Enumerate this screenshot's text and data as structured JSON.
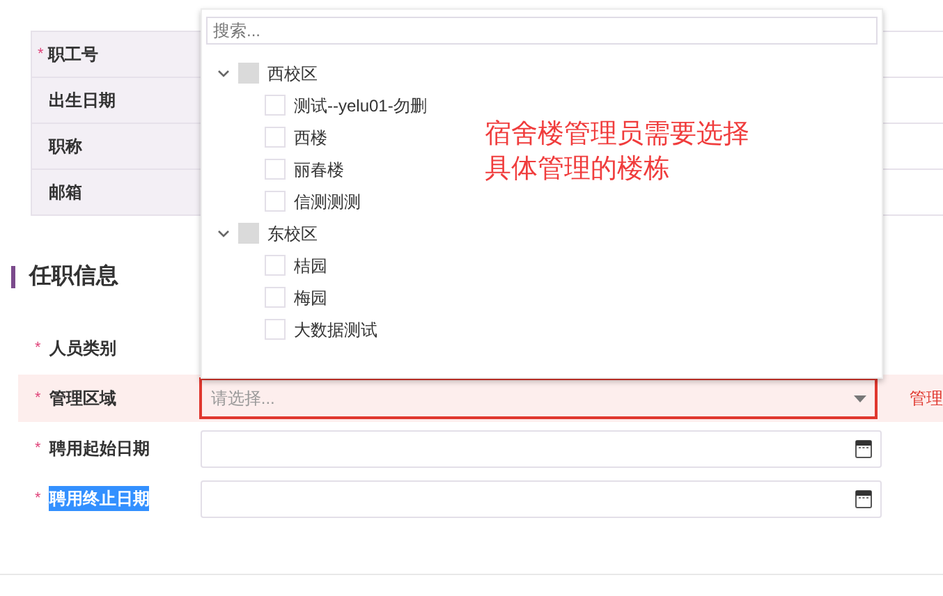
{
  "info_table": {
    "rows": [
      {
        "label": "职工号",
        "required_mark": "*"
      },
      {
        "label": "出生日期"
      },
      {
        "label": "职称"
      },
      {
        "label": "邮箱"
      }
    ]
  },
  "section_title": "任职信息",
  "form": {
    "rows": [
      {
        "label": "人员类别",
        "required_mark": "*",
        "kind": "covered"
      },
      {
        "label": "管理区域",
        "required_mark": "*",
        "kind": "select",
        "placeholder": "请选择...",
        "error": true,
        "error_text": "管理"
      },
      {
        "label": "聘用起始日期",
        "required_mark": "*",
        "kind": "date"
      },
      {
        "label": "聘用终止日期",
        "required_mark": "*",
        "kind": "date",
        "text_selected": true
      }
    ]
  },
  "dropdown": {
    "search_placeholder": "搜索...",
    "tree": [
      {
        "label": "西校区",
        "expanded": true,
        "checked": false,
        "children": [
          {
            "label": "测试--yelu01-勿删",
            "checked": false
          },
          {
            "label": "西楼",
            "checked": false
          },
          {
            "label": "丽春楼",
            "checked": false
          },
          {
            "label": "信测测测",
            "checked": false
          }
        ]
      },
      {
        "label": "东校区",
        "expanded": true,
        "checked": false,
        "children": [
          {
            "label": "桔园",
            "checked": false
          },
          {
            "label": "梅园",
            "checked": false
          },
          {
            "label": "大数据测试",
            "checked": false
          }
        ]
      }
    ]
  },
  "annotation": [
    "宿舍楼管理员需要选择",
    "具体管理的楼栋"
  ]
}
